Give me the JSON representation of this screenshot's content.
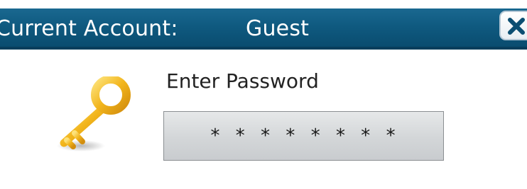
{
  "titlebar": {
    "label": "Current Account:",
    "account": "Guest",
    "close_icon": "close-icon"
  },
  "prompt": {
    "label": "Enter Password"
  },
  "password": {
    "value": "* * * * * * * *"
  },
  "icons": {
    "key": "key-icon"
  },
  "colors": {
    "titlebar": "#0f5a80",
    "key": "#f2b51c",
    "field": "#d3d6d8"
  }
}
